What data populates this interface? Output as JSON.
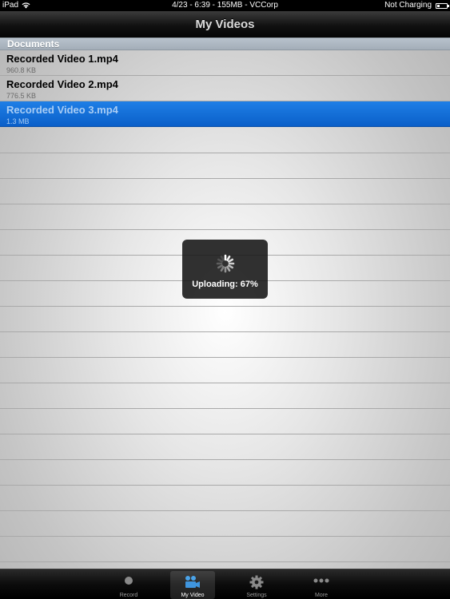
{
  "status_bar": {
    "device": "iPad",
    "center_text": "4/23 - 6:39 - 155MB - VCCorp",
    "charging": "Not Charging"
  },
  "nav": {
    "title": "My Videos"
  },
  "section": {
    "title": "Documents"
  },
  "videos": [
    {
      "name": "Recorded Video 1.mp4",
      "size": "960.8 KB"
    },
    {
      "name": "Recorded Video 2.mp4",
      "size": "776.5 KB"
    },
    {
      "name": "Recorded Video 3.mp4",
      "size": "1.3 MB"
    }
  ],
  "upload": {
    "status": "Uploading: 67%",
    "progress": 0.67
  },
  "tabs": [
    {
      "label": "Record",
      "icon": "record-icon"
    },
    {
      "label": "My Video",
      "icon": "video-camera-icon"
    },
    {
      "label": "Settings",
      "icon": "gear-icon"
    },
    {
      "label": "More",
      "icon": "more-dots-icon"
    }
  ],
  "colors": {
    "selection": "#1470d8",
    "nav_bar": "#111111"
  }
}
